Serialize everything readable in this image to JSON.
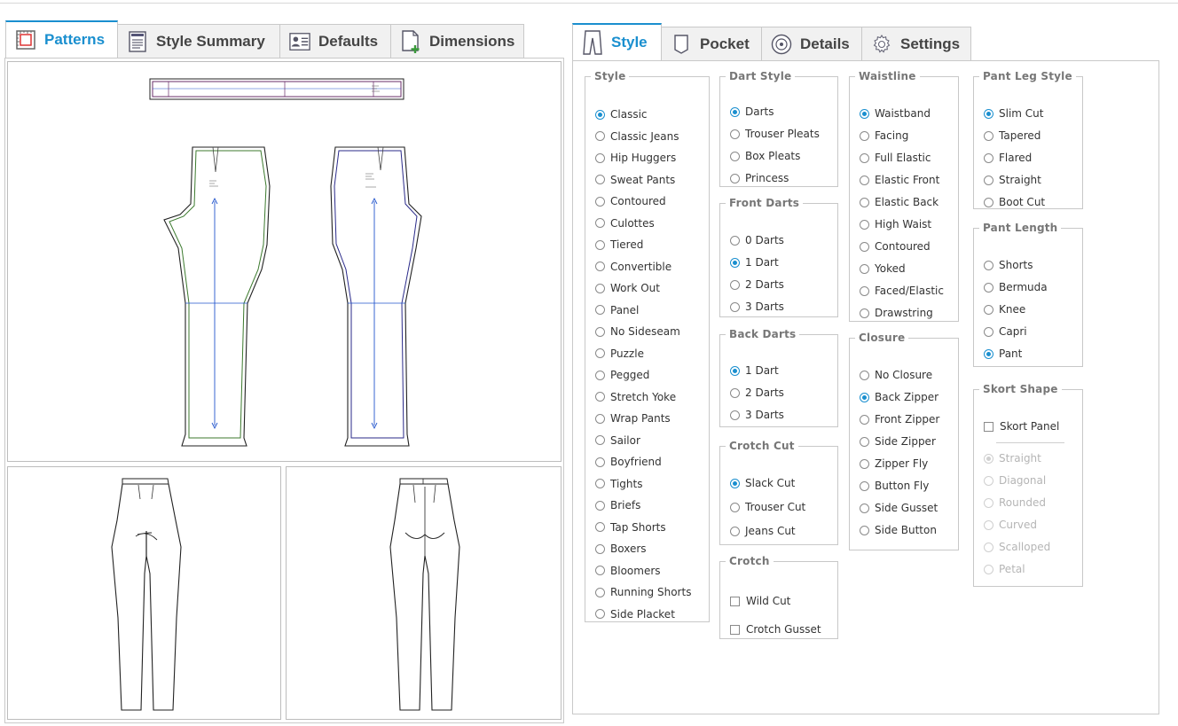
{
  "left_tabs": [
    {
      "label": "Patterns",
      "icon": "patterns-icon"
    },
    {
      "label": "Style Summary",
      "icon": "style-summary-icon"
    },
    {
      "label": "Defaults",
      "icon": "defaults-icon"
    },
    {
      "label": "Dimensions",
      "icon": "dimensions-icon"
    }
  ],
  "right_tabs": [
    {
      "label": "Style",
      "icon": "pants-icon"
    },
    {
      "label": "Pocket",
      "icon": "pocket-icon"
    },
    {
      "label": "Details",
      "icon": "details-icon"
    },
    {
      "label": "Settings",
      "icon": "gear-icon"
    }
  ],
  "active_left_tab": "Patterns",
  "active_right_tab": "Style",
  "groups": {
    "style": {
      "title": "Style",
      "selected": "Classic",
      "options": [
        "Classic",
        "Classic Jeans",
        "Hip Huggers",
        "Sweat Pants",
        "Contoured",
        "Culottes",
        "Tiered",
        "Convertible",
        "Work Out",
        "Panel",
        "No Sideseam",
        "Puzzle",
        "Pegged",
        "Stretch Yoke",
        "Wrap Pants",
        "Sailor",
        "Boyfriend",
        "Tights",
        "Briefs",
        "Tap Shorts",
        "Boxers",
        "Bloomers",
        "Running Shorts",
        "Side Placket"
      ]
    },
    "dart_style": {
      "title": "Dart Style",
      "selected": "Darts",
      "options": [
        "Darts",
        "Trouser Pleats",
        "Box Pleats",
        "Princess"
      ]
    },
    "front_darts": {
      "title": "Front Darts",
      "selected": "1 Dart",
      "options": [
        "0 Darts",
        "1 Dart",
        "2 Darts",
        "3 Darts"
      ]
    },
    "back_darts": {
      "title": "Back Darts",
      "selected": "1 Dart",
      "options": [
        "1 Dart",
        "2 Darts",
        "3 Darts"
      ]
    },
    "crotch_cut": {
      "title": "Crotch Cut",
      "selected": "Slack Cut",
      "options": [
        "Slack Cut",
        "Trouser Cut",
        "Jeans Cut"
      ]
    },
    "crotch": {
      "title": "Crotch",
      "checkboxes": [
        {
          "label": "Wild Cut",
          "checked": false
        },
        {
          "label": "Crotch Gusset",
          "checked": false
        }
      ]
    },
    "waistline": {
      "title": "Waistline",
      "selected": "Waistband",
      "options": [
        "Waistband",
        "Facing",
        "Full Elastic",
        "Elastic Front",
        "Elastic Back",
        "High Waist",
        "Contoured",
        "Yoked",
        "Faced/Elastic",
        "Drawstring"
      ]
    },
    "closure": {
      "title": "Closure",
      "selected": "Back Zipper",
      "options": [
        "No Closure",
        "Back Zipper",
        "Front Zipper",
        "Side Zipper",
        "Zipper Fly",
        "Button Fly",
        "Side Gusset",
        "Side Button"
      ]
    },
    "pant_leg_style": {
      "title": "Pant Leg Style",
      "selected": "Slim Cut",
      "options": [
        "Slim Cut",
        "Tapered",
        "Flared",
        "Straight",
        "Boot Cut"
      ]
    },
    "pant_length": {
      "title": "Pant Length",
      "selected": "Pant",
      "options": [
        "Shorts",
        "Bermuda",
        "Knee",
        "Capri",
        "Pant"
      ]
    },
    "skort_shape": {
      "title": "Skort Shape",
      "checkbox": {
        "label": "Skort Panel",
        "checked": false
      },
      "selected": "Straight",
      "disabled": true,
      "options": [
        "Straight",
        "Diagonal",
        "Rounded",
        "Curved",
        "Scalloped",
        "Petal"
      ]
    }
  },
  "colors": {
    "accent": "#1a8fcf",
    "border": "#c9c9c9",
    "front_outline": "#3c7a2e",
    "back_outline": "#2a2a8a",
    "grainline": "#2255cc"
  }
}
